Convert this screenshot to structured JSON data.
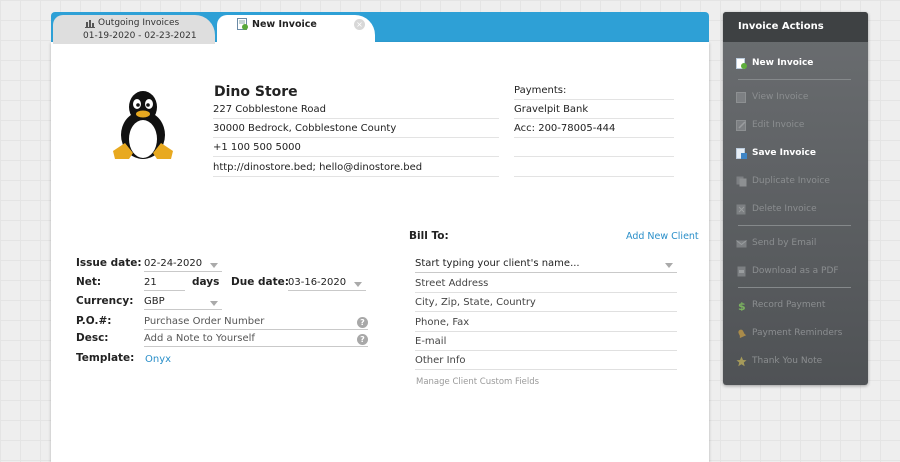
{
  "tabs": {
    "outgoing": {
      "title": "Outgoing Invoices",
      "range": "01-19-2020 - 02-23-2021"
    },
    "new_invoice": {
      "title": "New Invoice",
      "close": "×"
    }
  },
  "company": {
    "name": "Dino Store",
    "address1": "227 Cobblestone Road",
    "address2": "30000 Bedrock, Cobblestone County",
    "phone": "+1 100 500 5000",
    "web": "http://dinostore.bed; hello@dinostore.bed"
  },
  "payments": {
    "label": "Payments:",
    "bank": "Gravelpit Bank",
    "account": "Acc: 200-78005-444"
  },
  "form": {
    "issue_label": "Issue date:",
    "issue_value": "02-24-2020",
    "net_label": "Net:",
    "net_value": "21",
    "days_label": "days",
    "due_label": "Due date:",
    "due_value": "03-16-2020",
    "currency_label": "Currency:",
    "currency_value": "GBP",
    "po_label": "P.O.#:",
    "po_placeholder": "Purchase Order Number",
    "desc_label": "Desc:",
    "desc_placeholder": "Add a Note to Yourself",
    "template_label": "Template:",
    "template_value": "Onyx",
    "help_glyph": "?"
  },
  "bill_to": {
    "label": "Bill To:",
    "add_client": "Add New Client",
    "client_placeholder": "Start typing your client's name...",
    "street": "Street Address",
    "city": "City, Zip, State, Country",
    "phone": "Phone, Fax",
    "email": "E-mail",
    "other": "Other Info",
    "custom_fields": "Manage Client Custom Fields"
  },
  "actions": {
    "title": "Invoice Actions",
    "items": [
      {
        "label": "New Invoice",
        "icon": "new-invoice-icon",
        "enabled": true
      },
      {
        "label": "View Invoice",
        "icon": "view-invoice-icon",
        "enabled": false
      },
      {
        "label": "Edit Invoice",
        "icon": "edit-invoice-icon",
        "enabled": false
      },
      {
        "label": "Save Invoice",
        "icon": "save-invoice-icon",
        "enabled": true
      },
      {
        "label": "Duplicate Invoice",
        "icon": "duplicate-icon",
        "enabled": false
      },
      {
        "label": "Delete Invoice",
        "icon": "delete-icon",
        "enabled": false
      },
      {
        "label": "Send by Email",
        "icon": "email-icon",
        "enabled": false
      },
      {
        "label": "Download as a PDF",
        "icon": "pdf-icon",
        "enabled": false
      },
      {
        "label": "Record Payment",
        "icon": "dollar-icon",
        "enabled": false
      },
      {
        "label": "Payment Reminders",
        "icon": "bell-icon",
        "enabled": false
      },
      {
        "label": "Thank You Note",
        "icon": "star-icon",
        "enabled": false
      }
    ]
  },
  "colors": {
    "tab_bar": "#2ea0d6",
    "link": "#2a8fc9",
    "sidebar": "#5c5f62"
  }
}
